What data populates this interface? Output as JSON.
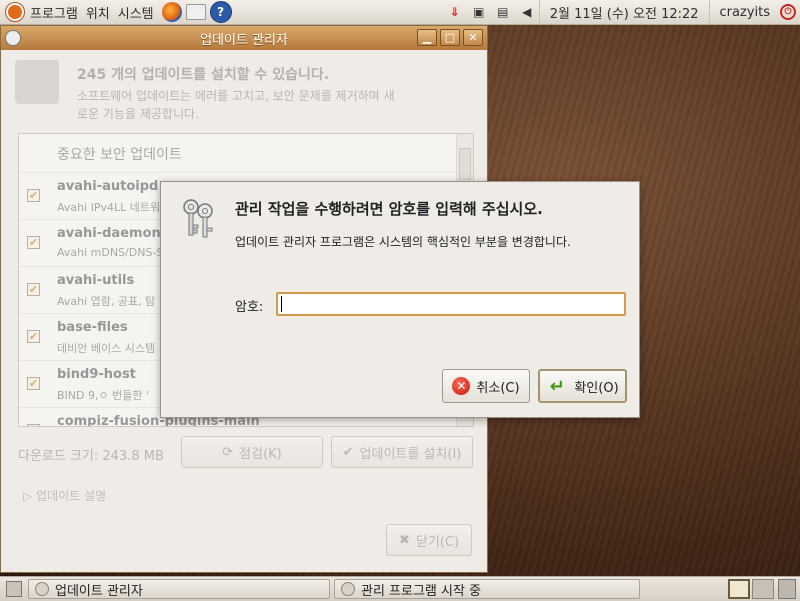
{
  "top_panel": {
    "menus": [
      "프로그램",
      "위치",
      "시스템"
    ],
    "clock": "2월 11일 (수) 오전 12:22",
    "user": "crazyits"
  },
  "update_window": {
    "title": "업데이트 관리자",
    "heading": "245 개의 업데이트를 설치할 수 있습니다.",
    "subtext": "소프트웨어 업데이트는 에러를 고치고, 보안 문제를 제거하며 새로운 기능을 제공합니다.",
    "section_header": "중요한 보안 업데이트",
    "packages": [
      {
        "name": "avahi-autoipd",
        "desc": "Avahi IPv4LL 네트워"
      },
      {
        "name": "avahi-daemon",
        "desc": "Avahi mDNS/DNS-S"
      },
      {
        "name": "avahi-utils",
        "desc": "Avahi 엽람, 공표, 탐"
      },
      {
        "name": "base-files",
        "desc": "데비안 베이스 시스템"
      },
      {
        "name": "bind9-host",
        "desc": "BIND 9,ㅇ 번들한 '"
      },
      {
        "name": "compiz-fusion-plugins-main",
        "desc": ""
      }
    ],
    "download_size": "다운로드 크기: 243.8 MB",
    "check_button": "점검(K)",
    "install_button": "업데이트를 설치(I)",
    "expander": "업데이트 설명",
    "close_button": "닫기(C)"
  },
  "auth_dialog": {
    "title": "관리 작업을 수행하려면 암호를 입력해 주십시오.",
    "message": "업데이트 관리자 프로그램은 시스템의 핵심적인 부분을 변경합니다.",
    "password_label": "암호:",
    "password_value": "",
    "cancel_button": "취소(C)",
    "ok_button": "확인(O)"
  },
  "bottom_panel": {
    "tasks": [
      "업데이트 관리자",
      "관리 프로그램 시작 중"
    ]
  },
  "colors": {
    "titlebar": "#b5793b",
    "focus_border": "#d19a4d",
    "ubuntu_orange": "#e06a1c"
  }
}
